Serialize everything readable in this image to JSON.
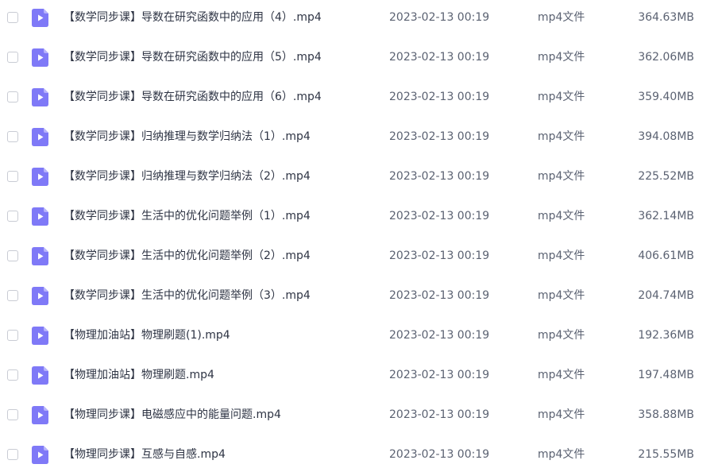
{
  "colors": {
    "icon_fill": "#7f79f7",
    "icon_fold": "#b7b3fb",
    "play_glyph": "#ffffff"
  },
  "files": [
    {
      "name": "【数学同步课】导数在研究函数中的应用（4）.mp4",
      "time": "2023-02-13 00:19",
      "type": "mp4文件",
      "size": "364.63MB",
      "icon": "video-file-icon"
    },
    {
      "name": "【数学同步课】导数在研究函数中的应用（5）.mp4",
      "time": "2023-02-13 00:19",
      "type": "mp4文件",
      "size": "362.06MB",
      "icon": "video-file-icon"
    },
    {
      "name": "【数学同步课】导数在研究函数中的应用（6）.mp4",
      "time": "2023-02-13 00:19",
      "type": "mp4文件",
      "size": "359.40MB",
      "icon": "video-file-icon"
    },
    {
      "name": "【数学同步课】归纳推理与数学归纳法（1）.mp4",
      "time": "2023-02-13 00:19",
      "type": "mp4文件",
      "size": "394.08MB",
      "icon": "video-file-icon"
    },
    {
      "name": "【数学同步课】归纳推理与数学归纳法（2）.mp4",
      "time": "2023-02-13 00:19",
      "type": "mp4文件",
      "size": "225.52MB",
      "icon": "video-file-icon"
    },
    {
      "name": "【数学同步课】生活中的优化问题举例（1）.mp4",
      "time": "2023-02-13 00:19",
      "type": "mp4文件",
      "size": "362.14MB",
      "icon": "video-file-icon"
    },
    {
      "name": "【数学同步课】生活中的优化问题举例（2）.mp4",
      "time": "2023-02-13 00:19",
      "type": "mp4文件",
      "size": "406.61MB",
      "icon": "video-file-icon"
    },
    {
      "name": "【数学同步课】生活中的优化问题举例（3）.mp4",
      "time": "2023-02-13 00:19",
      "type": "mp4文件",
      "size": "204.74MB",
      "icon": "video-file-icon"
    },
    {
      "name": "【物理加油站】物理刷题(1).mp4",
      "time": "2023-02-13 00:19",
      "type": "mp4文件",
      "size": "192.36MB",
      "icon": "video-file-icon"
    },
    {
      "name": "【物理加油站】物理刷题.mp4",
      "time": "2023-02-13 00:19",
      "type": "mp4文件",
      "size": "197.48MB",
      "icon": "video-file-icon"
    },
    {
      "name": "【物理同步课】电磁感应中的能量问题.mp4",
      "time": "2023-02-13 00:19",
      "type": "mp4文件",
      "size": "358.88MB",
      "icon": "video-file-icon"
    },
    {
      "name": "【物理同步课】互感与自感.mp4",
      "time": "2023-02-13 00:19",
      "type": "mp4文件",
      "size": "215.55MB",
      "icon": "video-file-icon"
    }
  ]
}
